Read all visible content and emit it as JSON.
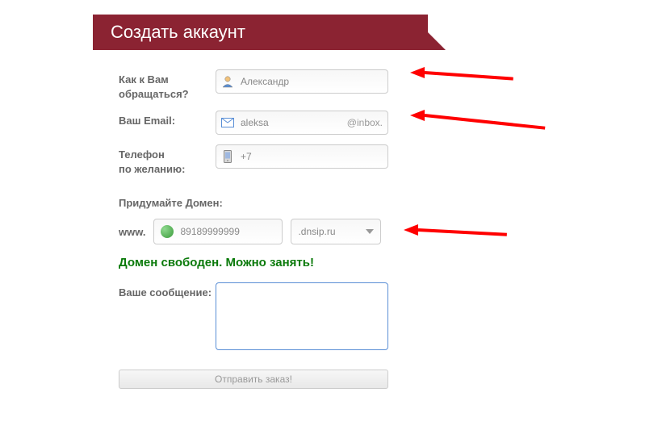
{
  "header": {
    "title": "Создать аккаунт"
  },
  "fields": {
    "name_label": "Как к Вам обращаться?",
    "name_value": "Александр",
    "email_label": "Ваш Email:",
    "email_value": "aleksa",
    "email_suffix": "@inbox.",
    "phone_label": "Телефон\nпо желанию:",
    "phone_value": "+7"
  },
  "domain": {
    "section_title": "Придумайте Домен:",
    "www": "www.",
    "value": "89189999999",
    "tld": ".dnsip.ru",
    "status": "Домен свободен. Можно занять!"
  },
  "message": {
    "label": "Ваше сообщение:",
    "value": ""
  },
  "submit": {
    "label": "Отправить заказ!"
  }
}
